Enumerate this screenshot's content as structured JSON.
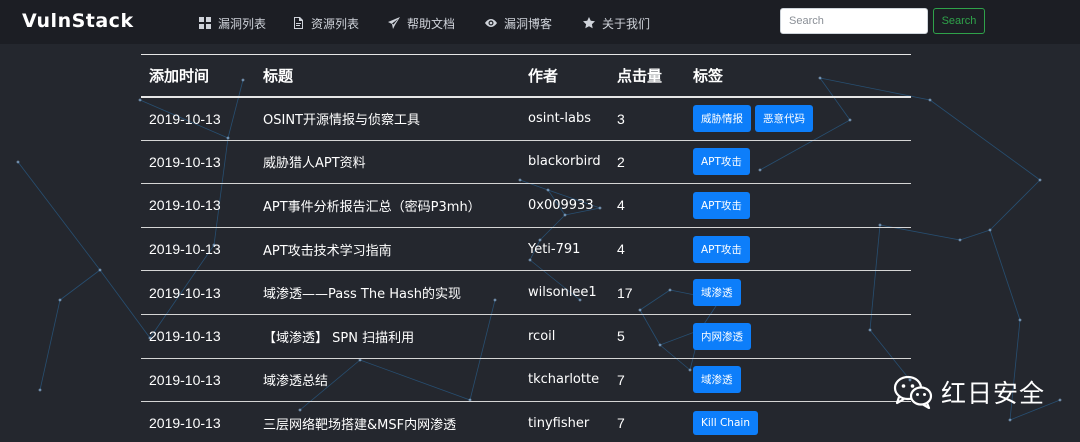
{
  "brand": "VulnStack",
  "nav": [
    {
      "label": "漏洞列表",
      "icon": "grid-icon"
    },
    {
      "label": "资源列表",
      "icon": "pdf-icon"
    },
    {
      "label": "帮助文档",
      "icon": "send-icon"
    },
    {
      "label": "漏洞博客",
      "icon": "eye-icon"
    },
    {
      "label": "关于我们",
      "icon": "star-icon"
    }
  ],
  "search": {
    "placeholder": "Search",
    "button": "Search"
  },
  "table": {
    "headers": [
      "添加时间",
      "标题",
      "作者",
      "点击量",
      "标签"
    ],
    "rows": [
      {
        "date": "2019-10-13",
        "title": "OSINT开源情报与侦察工具",
        "author": "osint-labs",
        "views": "3",
        "tags": [
          "威胁情报",
          "恶意代码"
        ]
      },
      {
        "date": "2019-10-13",
        "title": "威胁猎人APT资料",
        "author": "blackorbird",
        "views": "2",
        "tags": [
          "APT攻击"
        ]
      },
      {
        "date": "2019-10-13",
        "title": "APT事件分析报告汇总（密码P3mh）",
        "author": "0x009933",
        "views": "4",
        "tags": [
          "APT攻击"
        ]
      },
      {
        "date": "2019-10-13",
        "title": "APT攻击技术学习指南",
        "author": "Yeti-791",
        "views": "4",
        "tags": [
          "APT攻击"
        ]
      },
      {
        "date": "2019-10-13",
        "title": "域渗透——Pass The Hash的实现",
        "author": "wilsonlee1",
        "views": "17",
        "tags": [
          "域渗透"
        ]
      },
      {
        "date": "2019-10-13",
        "title": "【域渗透】 SPN 扫描利用",
        "author": "rcoil",
        "views": "5",
        "tags": [
          "内网渗透"
        ]
      },
      {
        "date": "2019-10-13",
        "title": "域渗透总结",
        "author": "tkcharlotte",
        "views": "7",
        "tags": [
          "域渗透"
        ]
      },
      {
        "date": "2019-10-13",
        "title": "三层网络靶场搭建&MSF内网渗透",
        "author": "tinyfisher",
        "views": "7",
        "tags": [
          "Kill Chain"
        ]
      }
    ]
  },
  "watermark": "红日安全",
  "colors": {
    "background": "#24272e",
    "navbar": "#1c1e24",
    "tag": "#0d7efa",
    "search_button": "#2fa24a",
    "network_lines": "#2a6fa8"
  }
}
